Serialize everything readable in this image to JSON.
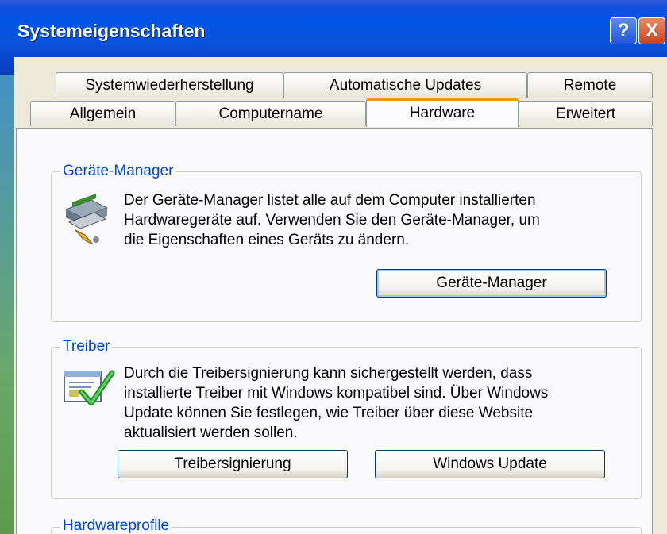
{
  "window": {
    "title": "Systemeigenschaften",
    "help_glyph": "?",
    "close_glyph": "X"
  },
  "tabs": {
    "row1": [
      "Systemwiederherstellung",
      "Automatische Updates",
      "Remote"
    ],
    "row2": [
      "Allgemein",
      "Computername",
      "Hardware",
      "Erweitert"
    ],
    "active": "Hardware"
  },
  "device_manager": {
    "legend": "Geräte-Manager",
    "lines": [
      "Der Geräte-Manager listet alle auf dem Computer installierten",
      "Hardwaregeräte auf. Verwenden Sie den Geräte-Manager, um",
      "die Eigenschaften eines Geräts zu ändern."
    ],
    "button": "Geräte-Manager",
    "icon": "device-manager-icon"
  },
  "drivers": {
    "legend": "Treiber",
    "lines": [
      "Durch die Treibersignierung kann sichergestellt werden, dass",
      "installierte Treiber mit Windows kompatibel sind. Über Windows",
      "Update können Sie festlegen, wie Treiber über diese Website",
      "aktualisiert werden sollen."
    ],
    "button_signing": "Treibersignierung",
    "button_update": "Windows Update",
    "icon": "driver-signing-icon"
  },
  "hardware_profiles": {
    "legend": "Hardwareprofile"
  },
  "colors": {
    "titlebar": "#0055e5",
    "active_tab_accent": "#e59a1f",
    "group_legend": "#0046d5",
    "dialog_bg": "#ece9d8"
  }
}
